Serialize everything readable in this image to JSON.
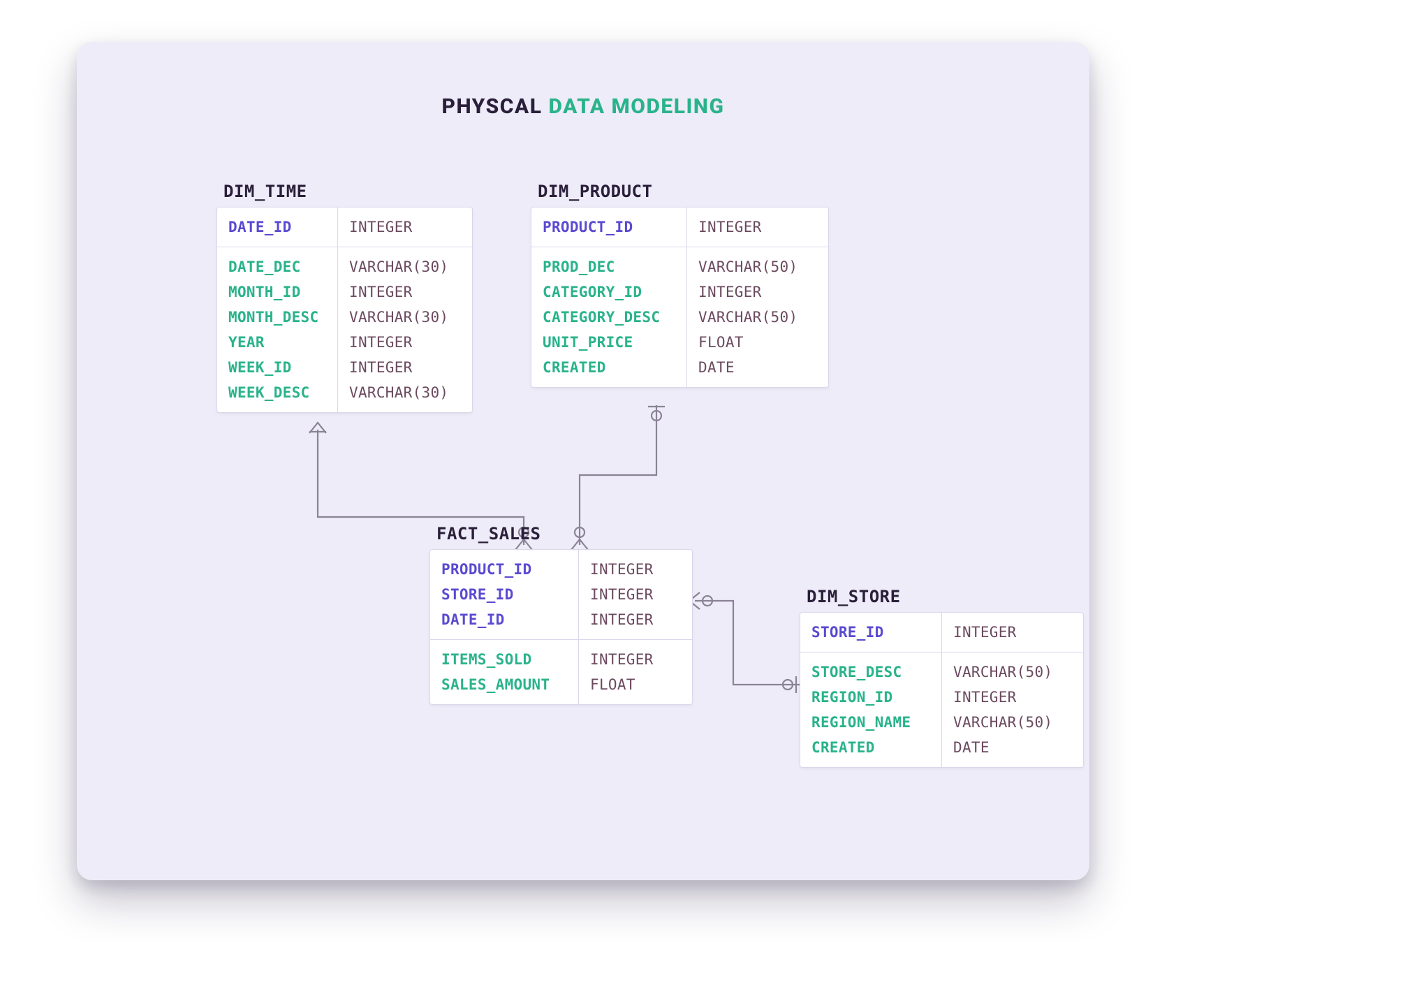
{
  "title": {
    "part1": "PHYSCAL",
    "part2": "DATA MODELING"
  },
  "entities": {
    "dim_time": {
      "name": "DIM_TIME",
      "pk": [
        {
          "name": "DATE_ID",
          "type": "INTEGER"
        }
      ],
      "attrs": [
        {
          "name": "DATE_DEC",
          "type": "VARCHAR(30)"
        },
        {
          "name": "MONTH_ID",
          "type": "INTEGER"
        },
        {
          "name": "MONTH_DESC",
          "type": "VARCHAR(30)"
        },
        {
          "name": "YEAR",
          "type": "INTEGER"
        },
        {
          "name": "WEEK_ID",
          "type": "INTEGER"
        },
        {
          "name": "WEEK_DESC",
          "type": "VARCHAR(30)"
        }
      ]
    },
    "dim_product": {
      "name": "DIM_PRODUCT",
      "pk": [
        {
          "name": "PRODUCT_ID",
          "type": "INTEGER"
        }
      ],
      "attrs": [
        {
          "name": "PROD_DEC",
          "type": "VARCHAR(50)"
        },
        {
          "name": "CATEGORY_ID",
          "type": "INTEGER"
        },
        {
          "name": "CATEGORY_DESC",
          "type": "VARCHAR(50)"
        },
        {
          "name": "UNIT_PRICE",
          "type": "FLOAT"
        },
        {
          "name": "CREATED",
          "type": "DATE"
        }
      ]
    },
    "fact_sales": {
      "name": "FACT_SALES",
      "pk": [
        {
          "name": "PRODUCT_ID",
          "type": "INTEGER"
        },
        {
          "name": "STORE_ID",
          "type": "INTEGER"
        },
        {
          "name": "DATE_ID",
          "type": "INTEGER"
        }
      ],
      "attrs": [
        {
          "name": "ITEMS_SOLD",
          "type": "INTEGER"
        },
        {
          "name": "SALES_AMOUNT",
          "type": "FLOAT"
        }
      ]
    },
    "dim_store": {
      "name": "DIM_STORE",
      "pk": [
        {
          "name": "STORE_ID",
          "type": "INTEGER"
        }
      ],
      "attrs": [
        {
          "name": "STORE_DESC",
          "type": "VARCHAR(50)"
        },
        {
          "name": "REGION_ID",
          "type": "INTEGER"
        },
        {
          "name": "REGION_NAME",
          "type": "VARCHAR(50)"
        },
        {
          "name": "CREATED",
          "type": "DATE"
        }
      ]
    }
  },
  "relationships": [
    {
      "from": "dim_time",
      "to": "fact_sales",
      "from_card": "one",
      "to_card": "many"
    },
    {
      "from": "dim_product",
      "to": "fact_sales",
      "from_card": "one",
      "to_card": "many"
    },
    {
      "from": "dim_store",
      "to": "fact_sales",
      "from_card": "one",
      "to_card": "many"
    }
  ],
  "colors": {
    "background": "#eeecf8",
    "pk_color": "#5a4ad1",
    "attr_color": "#2ab38a",
    "type_color": "#6b4a5f",
    "connector_color": "#8a8396",
    "title_dark": "#2a1f3a",
    "title_accent": "#2ab38a"
  }
}
